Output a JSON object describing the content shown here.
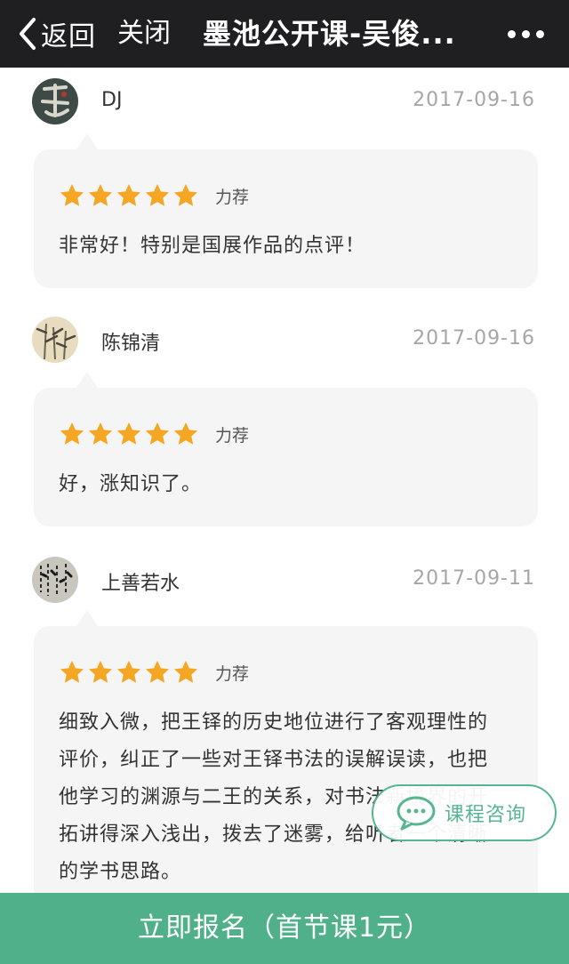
{
  "topbar": {
    "back_label": "返回",
    "close_label": "关闭",
    "title": "墨池公开课-吴俊..."
  },
  "reviews": [
    {
      "name": "DJ",
      "date": "2017-09-16",
      "stars": 5,
      "rating_label": "力荐",
      "comment": "非常好！特别是国展作品的点评！",
      "avatar_icon": "calligraphy-avatar"
    },
    {
      "name": "陈锦清",
      "date": "2017-09-16",
      "stars": 5,
      "rating_label": "力荐",
      "comment": "好，涨知识了。",
      "avatar_icon": "bamboo-painting-avatar"
    },
    {
      "name": "上善若水",
      "date": "2017-09-11",
      "stars": 5,
      "rating_label": "力荐",
      "comment": "细致入微，把王铎的历史地位进行了客观理性的评价，纠正了一些对王铎书法的误解误读，也把他学习的渊源与二王的关系，对书法新境界的开拓讲得深入浅出，拨去了迷雾，给听者一个清晰的学书思路。",
      "avatar_icon": "script-avatar"
    }
  ],
  "consult": {
    "label": "课程咨询",
    "icon": "chat-bubble-icon"
  },
  "enroll": {
    "label": "立即报名（首节课1元）"
  },
  "colors": {
    "topbar": "#1f1f21",
    "accent_green": "#4fb08a",
    "star": "#f5a623",
    "bubble": "#f5f5f5"
  }
}
